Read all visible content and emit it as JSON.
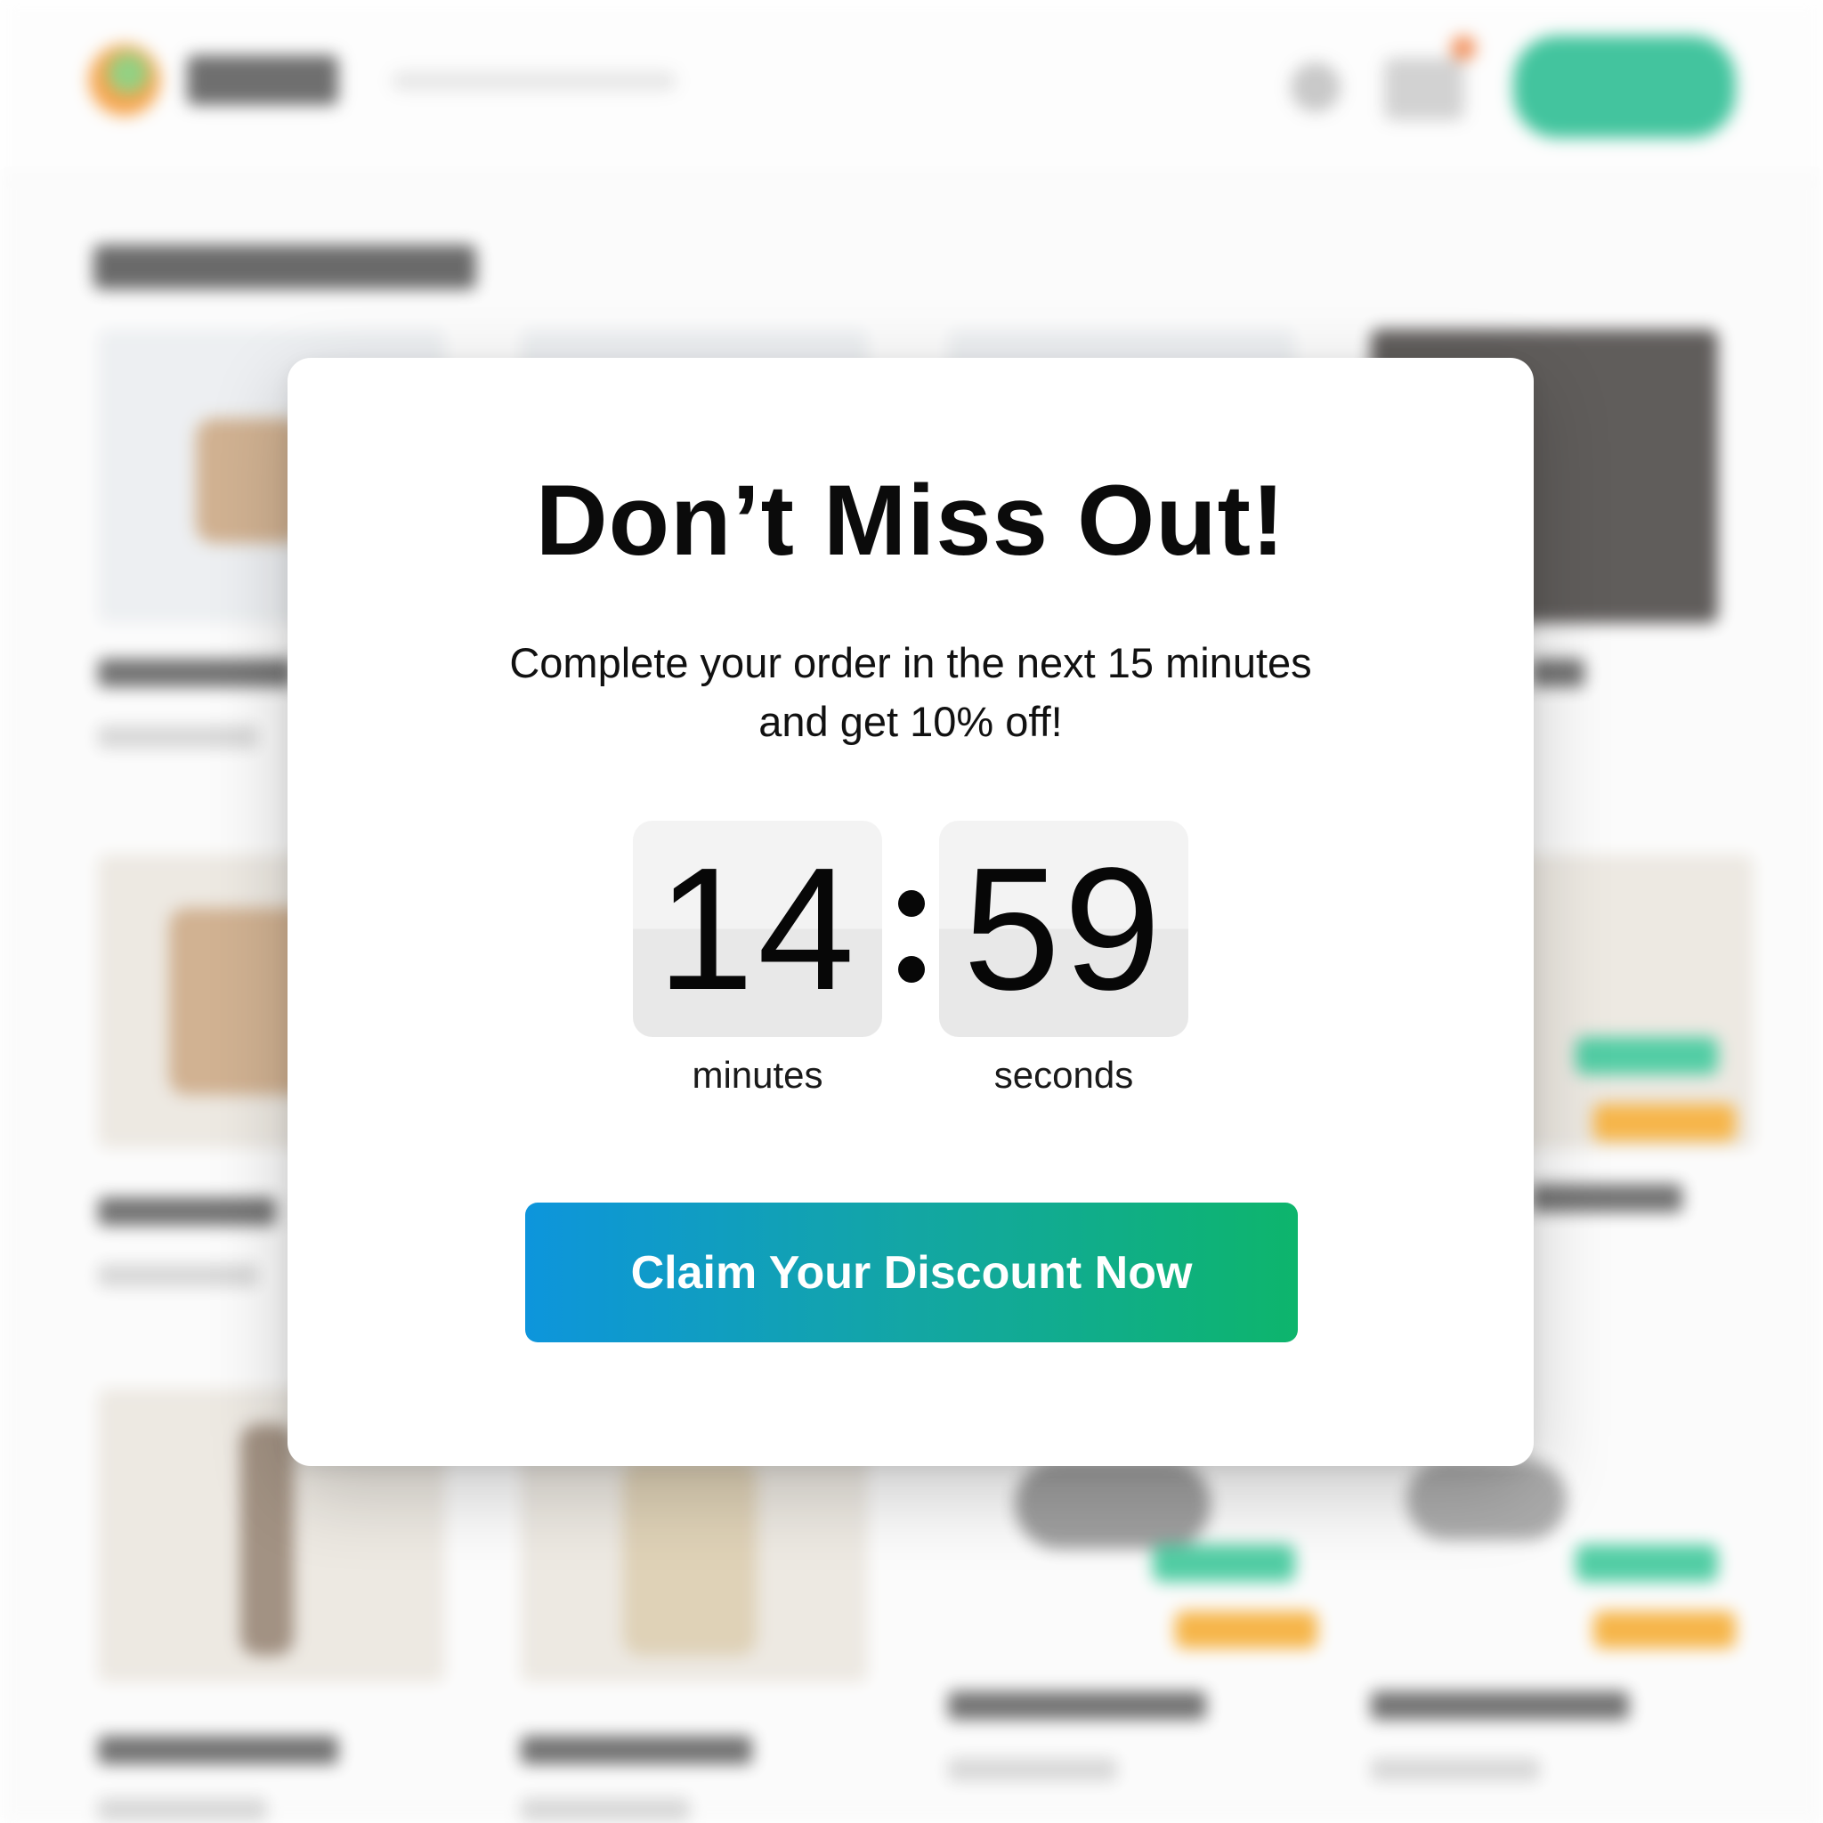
{
  "modal": {
    "title": "Don’t Miss Out!",
    "subtitle_line1": "Complete your order in the next 15 minutes",
    "subtitle_line2": "and get 10% off!",
    "timer": {
      "minutes": "14",
      "seconds": "59",
      "minutes_label": "minutes",
      "seconds_label": "seconds"
    },
    "cta_label": "Claim Your Discount Now"
  },
  "colors": {
    "cta_gradient_start": "#0d95dc",
    "cta_gradient_end": "#0db56c",
    "background_signin_button": "#1ab889",
    "price_badge_green": "#2dc391",
    "price_badge_orange": "#f5a623"
  },
  "icons": {
    "header": [
      "brand-logo-icon",
      "user-icon",
      "cart-icon"
    ]
  }
}
